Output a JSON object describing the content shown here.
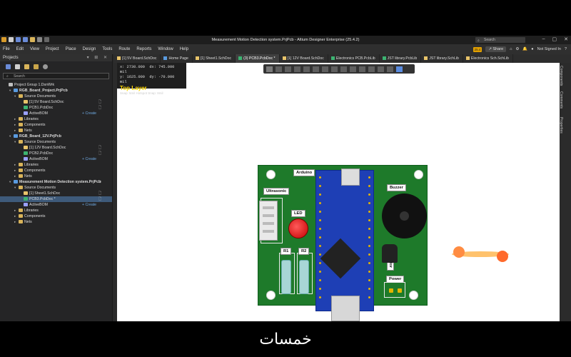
{
  "window": {
    "title": "Measurement Motion Detection system.PrjPcb - Altium Designer Enterprise (25.4.2)",
    "search_placeholder": "Search"
  },
  "menu": {
    "items": [
      "File",
      "Edit",
      "View",
      "Project",
      "Place",
      "Design",
      "Tools",
      "Route",
      "Reports",
      "Window",
      "Help"
    ],
    "badge": "25.4",
    "share_label": "Share",
    "user_label": "Not Signed In"
  },
  "panel": {
    "title": "Projects",
    "search_placeholder": "Search",
    "tree": [
      {
        "label": "Project Group 1.DsnWrk",
        "level": 0,
        "bold": false,
        "arrow": "",
        "icon": "group"
      },
      {
        "label": "RGB_Board_Project.PrjPcb",
        "level": 1,
        "bold": true,
        "arrow": "▾",
        "icon": "project"
      },
      {
        "label": "Source Documents",
        "level": 2,
        "bold": false,
        "arrow": "▾",
        "icon": "folder"
      },
      {
        "label": "[1] 5V Board.SchDoc",
        "level": 3,
        "bold": false,
        "arrow": "",
        "icon": "sch",
        "doc": "🗋"
      },
      {
        "label": "PCB1.PcbDoc",
        "level": 3,
        "bold": false,
        "arrow": "",
        "icon": "pcb",
        "doc": "🗋"
      },
      {
        "label": "ActiveBOM",
        "level": 3,
        "bold": false,
        "arrow": "",
        "icon": "bom",
        "add": "+ Create"
      },
      {
        "label": "Libraries",
        "level": 2,
        "bold": false,
        "arrow": "▸",
        "icon": "folder"
      },
      {
        "label": "Components",
        "level": 2,
        "bold": false,
        "arrow": "▸",
        "icon": "folder"
      },
      {
        "label": "Nets",
        "level": 2,
        "bold": false,
        "arrow": "▸",
        "icon": "folder"
      },
      {
        "label": "RGB_Board_12V.PrjPcb",
        "level": 1,
        "bold": true,
        "arrow": "▾",
        "icon": "project"
      },
      {
        "label": "Source Documents",
        "level": 2,
        "bold": false,
        "arrow": "▾",
        "icon": "folder"
      },
      {
        "label": "[1] 12V Board.SchDoc",
        "level": 3,
        "bold": false,
        "arrow": "",
        "icon": "sch",
        "doc": "🗋"
      },
      {
        "label": "PCB2.PcbDoc",
        "level": 3,
        "bold": false,
        "arrow": "",
        "icon": "pcb",
        "doc": "🗋"
      },
      {
        "label": "ActiveBOM",
        "level": 3,
        "bold": false,
        "arrow": "",
        "icon": "bom",
        "add": "+ Create"
      },
      {
        "label": "Libraries",
        "level": 2,
        "bold": false,
        "arrow": "▸",
        "icon": "folder"
      },
      {
        "label": "Components",
        "level": 2,
        "bold": false,
        "arrow": "▸",
        "icon": "folder"
      },
      {
        "label": "Nets",
        "level": 2,
        "bold": false,
        "arrow": "▸",
        "icon": "folder"
      },
      {
        "label": "Measurement Motion Detection system.PrjPcb",
        "level": 1,
        "bold": true,
        "arrow": "▾",
        "icon": "project",
        "doc": "⊘"
      },
      {
        "label": "Source Documents",
        "level": 2,
        "bold": false,
        "arrow": "▾",
        "icon": "folder"
      },
      {
        "label": "[1] Sheet1.SchDoc",
        "level": 3,
        "bold": false,
        "arrow": "",
        "icon": "sch",
        "doc": "🗋"
      },
      {
        "label": "PCB3.PcbDoc *",
        "level": 3,
        "bold": false,
        "arrow": "",
        "icon": "pcb",
        "selected": true,
        "doc": "🗋"
      },
      {
        "label": "ActiveBOM",
        "level": 3,
        "bold": false,
        "arrow": "",
        "icon": "bom",
        "add": "+ Create"
      },
      {
        "label": "Libraries",
        "level": 2,
        "bold": false,
        "arrow": "▸",
        "icon": "folder"
      },
      {
        "label": "Components",
        "level": 2,
        "bold": false,
        "arrow": "▸",
        "icon": "folder"
      },
      {
        "label": "Nets",
        "level": 2,
        "bold": false,
        "arrow": "▸",
        "icon": "folder"
      }
    ]
  },
  "tabs": [
    {
      "label": "[1] 5V Board.SchDoc",
      "color": "#e8c46a"
    },
    {
      "label": "Home Page",
      "color": "#5a9be0"
    },
    {
      "label": "[1] Sheet1.SchDoc",
      "color": "#e8c46a"
    },
    {
      "label": "(3) PCB3.PcbDoc *",
      "color": "#3cb371",
      "active": true
    },
    {
      "label": "[1] 12V Board.SchDoc",
      "color": "#e8c46a"
    },
    {
      "label": "Electronics PCB.PcbLib",
      "color": "#3cb371"
    },
    {
      "label": "JST library.PcbLib",
      "color": "#3cb371"
    },
    {
      "label": "JST library.SchLib",
      "color": "#e8c46a"
    },
    {
      "label": "Electronics Sch.SchLib",
      "color": "#e8c46a"
    }
  ],
  "coords": {
    "x_label": "x:",
    "x_val": "2730.000",
    "dx_label": "dx:",
    "dx_val": "745.000",
    "y_label": "y:",
    "y_val": "1625.000",
    "dy_label": "dy:",
    "dy_val": "-70.000",
    "unit": "mil",
    "layer": "Top Layer",
    "snap": "Snap: 5mil Hotspot Snap: 8mil"
  },
  "right_strip": [
    "Components",
    "Comments",
    "Properties"
  ],
  "pcb": {
    "labels": {
      "arduino": "Arduino",
      "ultrasonic": "Ultrasonic",
      "led": "LED",
      "buzzer": "Buzzer",
      "r1": "R1",
      "r2": "R2",
      "transistor": "Transistor",
      "power": "Power"
    }
  },
  "watermark": "خمسات"
}
